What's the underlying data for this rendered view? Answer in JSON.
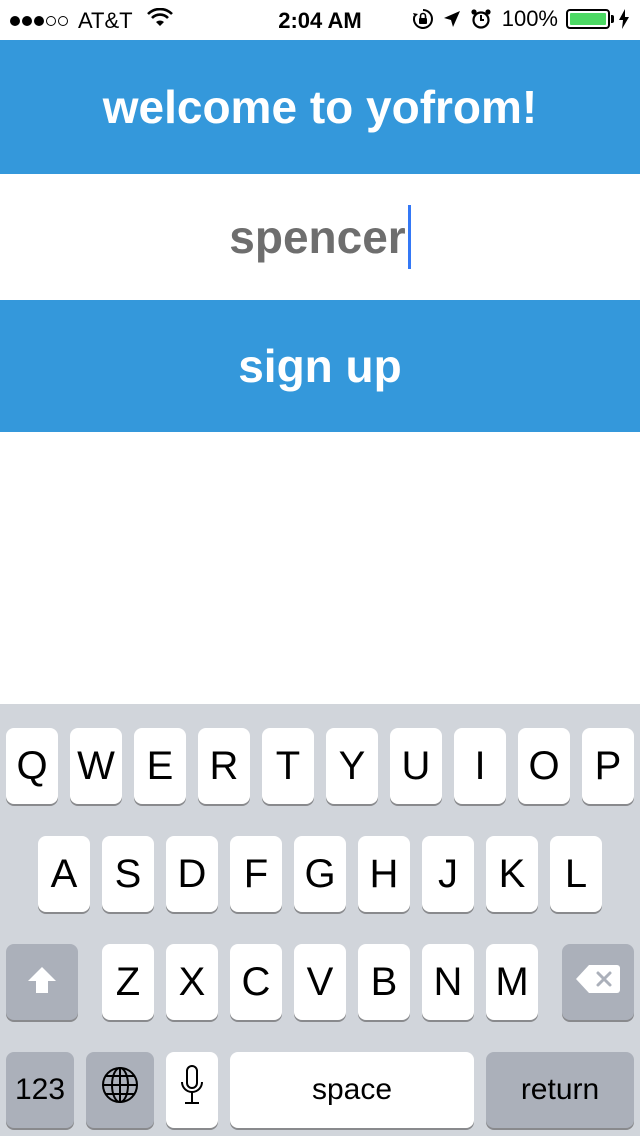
{
  "status_bar": {
    "carrier": "AT&T",
    "time": "2:04 AM",
    "battery_percent": "100%",
    "battery_level": 1.0,
    "signal_bars_filled": 3,
    "signal_bars_total": 5,
    "icons": [
      "wifi-icon",
      "rotation-lock-icon",
      "location-arrow-icon",
      "alarm-icon",
      "charging-bolt-icon"
    ]
  },
  "header": {
    "title": "welcome to yofrom!"
  },
  "username_field": {
    "value": "spencer"
  },
  "signup": {
    "label": "sign up"
  },
  "keyboard": {
    "row1": [
      "Q",
      "W",
      "E",
      "R",
      "T",
      "Y",
      "U",
      "I",
      "O",
      "P"
    ],
    "row2": [
      "A",
      "S",
      "D",
      "F",
      "G",
      "H",
      "J",
      "K",
      "L"
    ],
    "row3": [
      "Z",
      "X",
      "C",
      "V",
      "B",
      "N",
      "M"
    ],
    "numbers_label": "123",
    "space_label": "space",
    "return_label": "return",
    "icons": [
      "shift-icon",
      "delete-icon",
      "globe-icon",
      "microphone-icon"
    ]
  },
  "colors": {
    "accent": "#3498db",
    "caret": "#3478f6",
    "battery": "#4cd964",
    "keyboard_bg": "#d1d5db",
    "function_key": "#abb0ba"
  }
}
